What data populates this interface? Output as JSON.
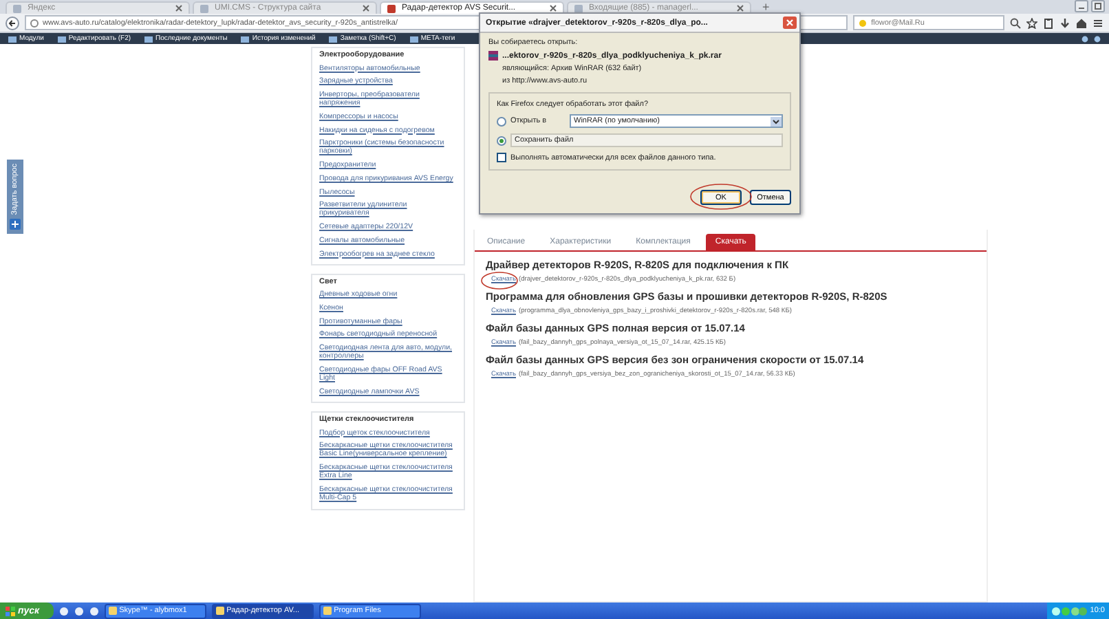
{
  "browser": {
    "tabs": [
      {
        "label": "Яндекс",
        "selected": false
      },
      {
        "label": "UMI.CMS - Структура сайта",
        "selected": false
      },
      {
        "label": "Радар-детектор AVS Securit...",
        "selected": true
      },
      {
        "label": "Входящие (885) - managerl...",
        "selected": false
      }
    ],
    "new_tab": "+",
    "url": "www.avs-auto.ru/catalog/elektronika/radar-detektory_lupk/radar-detektor_avs_security_r-920s_antistrelka/",
    "search": "flowor@Mail.Ru"
  },
  "bookmarks": [
    {
      "label": "Модули"
    },
    {
      "label": "Редактировать (F2)"
    },
    {
      "label": "Последние документы"
    },
    {
      "label": "История изменений"
    },
    {
      "label": "Заметка (Shift+C)"
    },
    {
      "label": "META-теги"
    }
  ],
  "feedback_tab": {
    "label": "Задать вопрос"
  },
  "sidebar": {
    "groups": [
      {
        "title": "Электрооборудование",
        "items": [
          "Вентиляторы автомобильные",
          "Зарядные устройства",
          "Инверторы, преобразователи напряжения",
          "Компрессоры и насосы",
          "Накидки на сиденья с подогревом",
          "Парктроники (системы безопасности парковки)",
          "Предохранители",
          "Провода для прикуривания AVS Energy",
          "Пылесосы",
          "Разветвители удлинители прикуривателя",
          "Сетевые адаптеры 220/12V",
          "Сигналы автомобильные",
          "Электрообогрев на заднее стекло"
        ]
      },
      {
        "title": "Свет",
        "items": [
          "Дневные ходовые огни",
          "Ксенон",
          "Противотуманные фары",
          "Фонарь светодиодный переносной",
          "Светодиодная лента для авто, модули, контроллеры",
          "Светодиодные фары OFF Road AVS Light",
          "Светодиодные лампочки AVS"
        ]
      },
      {
        "title": "Щетки стеклоочистителя",
        "items": [
          "Подбор щеток стеклоочистителя",
          "Бескаркасные щетки стеклоочистителя Basic Line(универсальное крепление)",
          "Бескаркасные щетки стеклоочистителя Extra Line",
          "Бескаркасные щетки стеклоочистителя Multi-Cap 5"
        ]
      }
    ]
  },
  "product": {
    "tabs": [
      {
        "label": "Описание",
        "selected": false
      },
      {
        "label": "Характеристики",
        "selected": false
      },
      {
        "label": "Комплектация",
        "selected": false
      },
      {
        "label": "Скачать",
        "selected": true
      }
    ],
    "downloads": [
      {
        "title": "Драйвер детекторов R-920S, R-820S для подключения к ПК",
        "link": "Скачать",
        "file": "(drajver_detektorov_r-920s_r-820s_dlya_podklyucheniya_k_pk.rar, 632 Б)"
      },
      {
        "title": "Программа для обновления GPS базы и прошивки детекторов R-920S, R-820S",
        "link": "Скачать",
        "file": "(programma_dlya_obnovleniya_gps_bazy_i_proshivki_detektorov_r-920s_r-820s.rar, 548 КБ)"
      },
      {
        "title": "Файл базы данных GPS полная версия от 15.07.14",
        "link": "Скачать",
        "file": "(fail_bazy_dannyh_gps_polnaya_versiya_ot_15_07_14.rar, 425.15 КБ)"
      },
      {
        "title": "Файл базы данных GPS версия без зон ограничения скорости от 15.07.14",
        "link": "Скачать",
        "file": "(fail_bazy_dannyh_gps_versiya_bez_zon_ogranicheniya_skorosti_ot_15_07_14.rar, 56.33 КБ)"
      }
    ]
  },
  "dialog": {
    "title": "Открытие «drajver_detektorov_r-920s_r-820s_dlya_po...",
    "intro": "Вы собираетесь открыть:",
    "file_name": "...ektorov_r-920s_r-820s_dlya_podklyucheniya_k_pk.rar",
    "file_type": "являющийся: Архив WinRAR (632 байт)",
    "source": "из http://www.avs-auto.ru",
    "question": "Как Firefox следует обработать этот файл?",
    "options": [
      {
        "kind": "open",
        "label": "Открыть в",
        "selected": false,
        "app": "WinRAR (по умолчанию)"
      },
      {
        "kind": "save",
        "label": "Сохранить файл",
        "selected": true
      }
    ],
    "auto": {
      "label": "Выполнять автоматически для всех файлов данного типа.",
      "checked": false
    },
    "buttons": [
      {
        "label": "OK",
        "default": true
      },
      {
        "label": "Отмена",
        "default": false
      }
    ]
  },
  "taskbar": {
    "start": "пуск",
    "tasks": [
      {
        "label": "Skype™ - alybmox1",
        "selected": false
      },
      {
        "label": "Радар-детектор AV...",
        "selected": true
      },
      {
        "label": "Program Files",
        "selected": false
      }
    ],
    "clock": "10:0"
  }
}
